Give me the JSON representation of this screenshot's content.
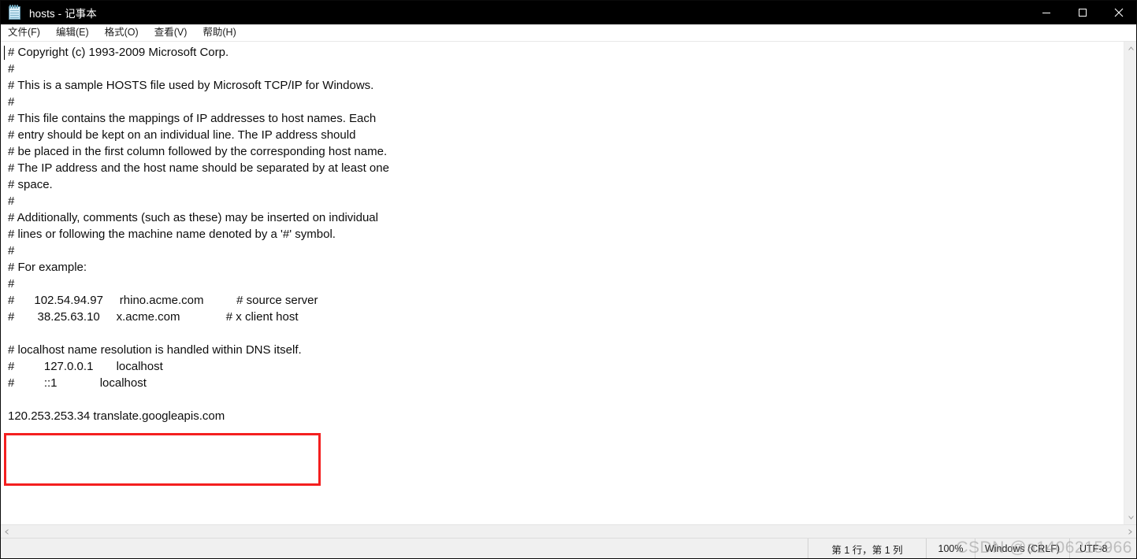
{
  "window": {
    "title": "hosts - 记事本",
    "icon": "notepad-icon",
    "controls": {
      "minimize": "–",
      "maximize": "□",
      "close": "✕"
    },
    "titlebar_color": "#000000"
  },
  "menubar": {
    "items": [
      {
        "label": "文件(F)"
      },
      {
        "label": "编辑(E)"
      },
      {
        "label": "格式(O)"
      },
      {
        "label": "查看(V)"
      },
      {
        "label": "帮助(H)"
      }
    ]
  },
  "editor": {
    "lines": [
      "# Copyright (c) 1993-2009 Microsoft Corp.",
      "#",
      "# This is a sample HOSTS file used by Microsoft TCP/IP for Windows.",
      "#",
      "# This file contains the mappings of IP addresses to host names. Each",
      "# entry should be kept on an individual line. The IP address should",
      "# be placed in the first column followed by the corresponding host name.",
      "# The IP address and the host name should be separated by at least one",
      "# space.",
      "#",
      "# Additionally, comments (such as these) may be inserted on individual",
      "# lines or following the machine name denoted by a '#' symbol.",
      "#",
      "# For example:",
      "#",
      "#      102.54.94.97     rhino.acme.com          # source server",
      "#       38.25.63.10     x.acme.com              # x client host",
      "",
      "# localhost name resolution is handled within DNS itself.",
      "#         127.0.0.1       localhost",
      "#         ::1             localhost",
      "",
      "120.253.253.34 translate.googleapis.com",
      "",
      "",
      "",
      "",
      ""
    ],
    "annotation": {
      "color": "#f41f1f",
      "highlighted_text": "120.253.253.34 translate.googleapis.com"
    }
  },
  "scrollbars": {
    "vertical": {
      "up_arrow": "▲",
      "down_arrow": "▼"
    },
    "horizontal": {
      "left_arrow": "◀",
      "right_arrow": "▶"
    }
  },
  "statusbar": {
    "line_col": "第 1 行，第 1 列",
    "zoom": "100%",
    "line_ending": "Windows (CRLF)",
    "encoding": "UTF-8"
  },
  "watermark": {
    "text": "CSDN @a1406215966"
  }
}
